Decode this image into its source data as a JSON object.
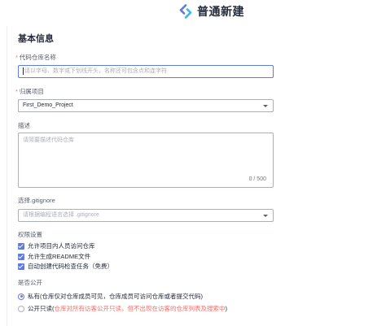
{
  "app": {
    "title": "普通新建",
    "logo_icon": "codearts-logo-icon",
    "accent_color": "#5e7ce0",
    "warning_color": "#f66f6a"
  },
  "section": {
    "title": "基本信息"
  },
  "repo_name": {
    "label": "代码仓库名称",
    "required": "*",
    "value": "",
    "placeholder": "请以字母、数字或下划线开头，名称还可包含点和连字符"
  },
  "project": {
    "label": "归属项目",
    "required": "*",
    "value": "First_Demo_Project"
  },
  "description": {
    "label": "描述",
    "placeholder": "请简要描述代码仓库",
    "counter": "0 / 500"
  },
  "gitignore": {
    "label": "选择.gitignore",
    "placeholder": "请根据编程语言选择 .gitignore"
  },
  "permissions": {
    "label": "权限设置",
    "items": [
      {
        "label": "允许项目内人员访问仓库",
        "checked": true
      },
      {
        "label": "允许生成README文件",
        "checked": true
      },
      {
        "label": "自动创建代码检查任务（免费）",
        "checked": true
      }
    ]
  },
  "visibility": {
    "label": "是否公开",
    "options": [
      {
        "label": "私有(仓库仅对仓库成员可见，仓库成员可访问仓库或者提交代码)",
        "selected": true
      },
      {
        "label_prefix": "公开只读(",
        "label_warning": "仓库对所有访客公开只读，但不出现在访客的仓库列表及搜索中",
        "label_suffix": ")",
        "selected": false
      }
    ]
  }
}
